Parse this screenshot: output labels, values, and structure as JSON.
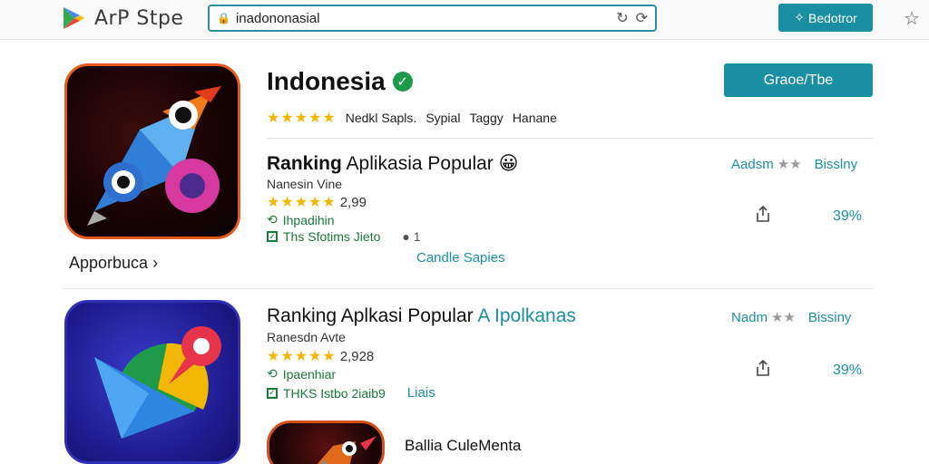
{
  "header": {
    "store_name": "ArP Stpe",
    "url": "inadononasial",
    "action_label": "Bedotror",
    "colors": {
      "accent": "#1a8fa3",
      "play_green": "#1b9a4b"
    }
  },
  "hero": {
    "apps_label": "Apporbuca",
    "app_title": "Indonesia",
    "stars": "★★★★★",
    "meta": [
      "Nedkl Sapls.",
      "Sypial",
      "Taggy",
      "Hanane"
    ],
    "install_label": "Graoe/Tbe"
  },
  "section1": {
    "title_bold": "Ranking",
    "title_rest": "Aplikasia Popular",
    "emoji": "😀",
    "subtitle": "Nanesin Vine",
    "stars": "★★★★★",
    "rating_count": "2,99",
    "green1": "Ihpadihin",
    "green2": "Ths Sfotims Jieto",
    "count_icon_text": "1",
    "link": "Candle Sapies",
    "rank_label": "Aadsm",
    "rank_stars": "★★",
    "rank_right": "Bisslny",
    "percent": "39%"
  },
  "section2": {
    "title": "Ranking Aplkasi Popular",
    "title_teal": "A Ipolkanas",
    "subtitle": "Ranesdn Avte",
    "stars": "★★★★★",
    "rating_count": "2,928",
    "green1": "Ipaenhiar",
    "green2": "THKS Istbo 2iaib9",
    "green_teal": "Liais",
    "rank_label": "Nadm",
    "rank_stars": "★★",
    "rank_right": "Bissiny",
    "percent": "39%"
  },
  "section3": {
    "title": "Ballia CuleMenta"
  }
}
